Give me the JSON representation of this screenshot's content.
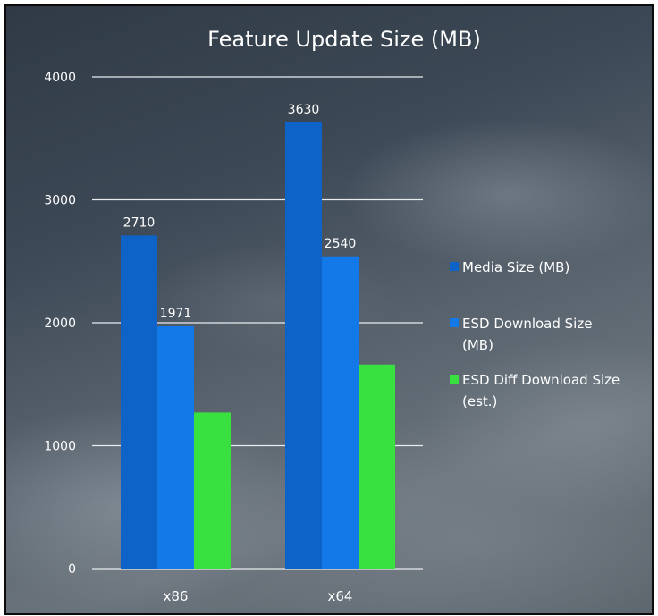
{
  "chart_data": {
    "type": "bar",
    "title": "Feature Update Size (MB)",
    "categories": [
      "x86",
      "x64"
    ],
    "ylim": [
      0,
      4000
    ],
    "yticks": [
      0,
      1000,
      2000,
      3000,
      4000
    ],
    "grid": true,
    "legend_position": "right",
    "series": [
      {
        "name": "Media Size (MB)",
        "values": [
          2710,
          3630
        ],
        "labels": [
          "2710",
          "3630"
        ],
        "color": "#0d63c8"
      },
      {
        "name": "ESD Download Size (MB)",
        "values": [
          1971,
          2540
        ],
        "labels": [
          "1971",
          "2540"
        ],
        "color": "#1378e8"
      },
      {
        "name": "ESD Diff Download Size (est.)",
        "values": [
          1270,
          1660
        ],
        "labels": [
          "",
          ""
        ],
        "color": "#39e140"
      }
    ],
    "legend_lines": [
      [
        "Media Size (MB)"
      ],
      [
        "ESD Download Size",
        "(MB)"
      ],
      [
        "ESD Diff Download Size",
        "(est.)"
      ]
    ]
  }
}
